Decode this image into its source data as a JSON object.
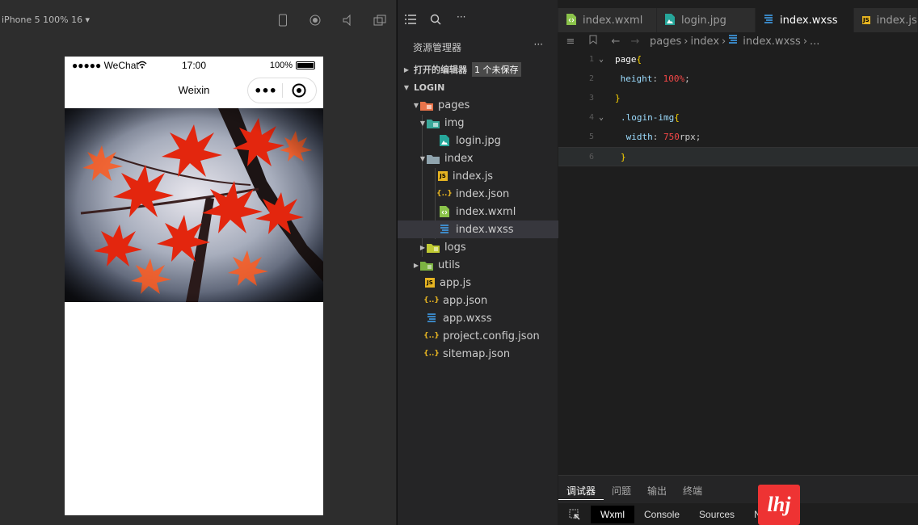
{
  "simulator": {
    "device": "iPhone 5 100% 16 ▾",
    "status": {
      "carrier": "●●●●● WeChat",
      "time": "17:00",
      "battery": "100%"
    },
    "nav_title": "Weixin",
    "capsule_dots": "•••"
  },
  "explorer": {
    "title": "资源管理器",
    "more": "···",
    "open_editors": "打开的编辑器",
    "unsaved_badge": "1 个未保存",
    "project": "LOGIN",
    "tree": [
      {
        "label": "pages"
      },
      {
        "label": "img"
      },
      {
        "label": "login.jpg"
      },
      {
        "label": "index"
      },
      {
        "label": "index.js"
      },
      {
        "label": "index.json"
      },
      {
        "label": "index.wxml"
      },
      {
        "label": "index.wxss"
      },
      {
        "label": "logs"
      },
      {
        "label": "utils"
      },
      {
        "label": "app.js"
      },
      {
        "label": "app.json"
      },
      {
        "label": "app.wxss"
      },
      {
        "label": "project.config.json"
      },
      {
        "label": "sitemap.json"
      }
    ]
  },
  "editor": {
    "tabs": [
      {
        "label": "index.wxml"
      },
      {
        "label": "login.jpg"
      },
      {
        "label": "index.wxss"
      },
      {
        "label": "index.js"
      }
    ],
    "breadcrumb": {
      "p1": "pages",
      "p2": "index",
      "file": "index.wxss",
      "more": "..."
    },
    "lines": {
      "n1": "1",
      "n2": "2",
      "n3": "3",
      "n4": "4",
      "n5": "5",
      "n6": "6",
      "l1_sel": "page",
      "l1_br": "{",
      "l2_prop": " height",
      "l2_colon": ": ",
      "l2_val": "100%",
      "l2_semi": ";",
      "l3_br": "}",
      "l4_sel": ".login-img",
      "l4_br": "{",
      "l5_prop": " width",
      "l5_colon": ": ",
      "l5_val": "750",
      "l5_unit": "rpx;",
      "l6_br": "}"
    }
  },
  "panel": {
    "tabs": [
      "调试器",
      "问题",
      "输出",
      "终端"
    ],
    "devtools": [
      "Wxml",
      "Console",
      "Sources",
      "Network"
    ]
  },
  "watermark": "lhj"
}
